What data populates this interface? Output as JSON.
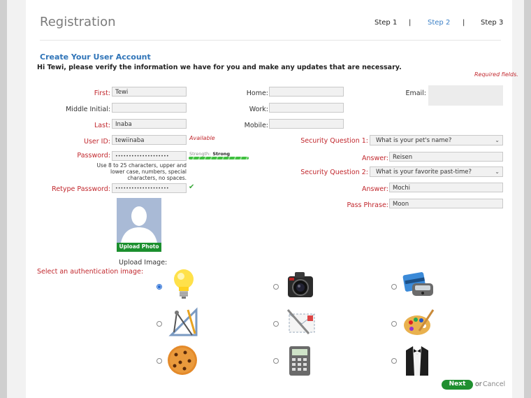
{
  "header": {
    "title": "Registration",
    "steps": [
      "Step 1",
      "Step 2",
      "Step 3"
    ],
    "separator": "|",
    "active_step": "Step 2"
  },
  "section": {
    "heading": "Create Your User Account",
    "intro": "Hi Tewi, please verify the information we have for you and make any updates that are necessary.",
    "required_note": "Required fields."
  },
  "form": {
    "first_label": "First:",
    "first_value": "Tewi",
    "middle_label": "Middle Initial:",
    "middle_value": "",
    "last_label": "Last:",
    "last_value": "Inaba",
    "userid_label": "User ID:",
    "userid_value": "tewiinaba",
    "userid_status": "Available",
    "password_label": "Password:",
    "password_value": "••••••••••••••••••••",
    "password_hint": [
      "Use 8 to 25 characters, upper and",
      "lower case, numbers, special",
      "characters, no spaces."
    ],
    "strength_label": "Strength:",
    "strength_value": "Strong",
    "strength_level": 1.0,
    "retype_label": "Retype Password:",
    "retype_value": "••••••••••••••••••••",
    "retype_ok": "✔",
    "home_label": "Home:",
    "home_value": "",
    "work_label": "Work:",
    "work_value": "",
    "mobile_label": "Mobile:",
    "mobile_value": "",
    "email_label": "Email:",
    "sq1_label": "Security Question 1:",
    "sq1_value": "What is your pet's name?",
    "answer1_label": "Answer:",
    "answer1_value": "Reisen",
    "sq2_label": "Security Question 2:",
    "sq2_value": "What is your favorite past-time?",
    "answer2_label": "Answer:",
    "answer2_value": "Mochi",
    "passphrase_label": "Pass Phrase:",
    "passphrase_value": "Moon",
    "chevron": "⌄"
  },
  "photo": {
    "upload_button": "Upload Photo",
    "upload_image_label": "Upload Image:"
  },
  "auth": {
    "label": "Select an authentication image:",
    "images": [
      {
        "name": "lightbulb-icon",
        "selected": true
      },
      {
        "name": "camera-icon",
        "selected": false
      },
      {
        "name": "credit-card-icon",
        "selected": false
      },
      {
        "name": "drafting-tools-icon",
        "selected": false
      },
      {
        "name": "envelope-icon",
        "selected": false
      },
      {
        "name": "paint-palette-icon",
        "selected": false
      },
      {
        "name": "cookie-icon",
        "selected": false
      },
      {
        "name": "calculator-icon",
        "selected": false
      },
      {
        "name": "tuxedo-icon",
        "selected": false
      }
    ]
  },
  "footer": {
    "next_label": "Next",
    "or_label": "or",
    "cancel_label": "Cancel"
  },
  "colors": {
    "accent_blue": "#2f74b8",
    "required_red": "#c1272d",
    "button_green": "#1f8f2f"
  }
}
